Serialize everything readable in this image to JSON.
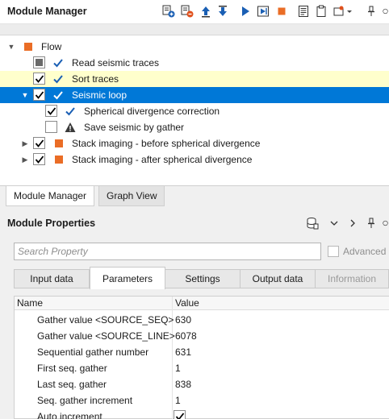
{
  "module_manager": {
    "title": "Module Manager",
    "toolbar": [
      {
        "name": "add-module-icon"
      },
      {
        "name": "remove-module-icon"
      },
      {
        "name": "move-up-icon"
      },
      {
        "name": "move-down-icon"
      },
      {
        "name": "run-icon"
      },
      {
        "name": "run-step-icon"
      },
      {
        "name": "stop-icon"
      },
      {
        "name": "log-icon"
      },
      {
        "name": "clipboard-icon"
      },
      {
        "name": "options-icon"
      },
      {
        "name": "pin-icon"
      }
    ],
    "tree": {
      "root": {
        "label": "Flow"
      },
      "items": [
        {
          "label": "Read seismic traces"
        },
        {
          "label": "Sort traces"
        },
        {
          "label": "Seismic loop"
        },
        {
          "label": "Spherical divergence correction"
        },
        {
          "label": "Save seismic by gather"
        },
        {
          "label": "Stack imaging - before spherical divergence"
        },
        {
          "label": "Stack imaging - after spherical divergence"
        }
      ]
    },
    "bottom_tabs": [
      "Module Manager",
      "Graph View"
    ]
  },
  "module_properties": {
    "title": "Module Properties",
    "search_placeholder": "Search Property",
    "advanced_label": "Advanced",
    "tabs": [
      "Input data",
      "Parameters",
      "Settings",
      "Output data",
      "Information"
    ],
    "active_tab": "Parameters",
    "columns": {
      "name": "Name",
      "value": "Value"
    },
    "rows": [
      {
        "name": "Gather value <SOURCE_SEQ>",
        "value": "630"
      },
      {
        "name": "Gather value <SOURCE_LINE>",
        "value": "6078"
      },
      {
        "name": "Sequential gather number",
        "value": "631"
      },
      {
        "name": "First seq. gather",
        "value": "1"
      },
      {
        "name": "Last seq. gather",
        "value": "838"
      },
      {
        "name": "Seq. gather increment",
        "value": "1"
      },
      {
        "name": "Auto increment",
        "value": ""
      }
    ]
  },
  "colors": {
    "selected_row": "#0078d7",
    "highlight_row": "#ffffcc",
    "module_square": "#ea6d26",
    "check_blue": "#1a5fb4"
  }
}
